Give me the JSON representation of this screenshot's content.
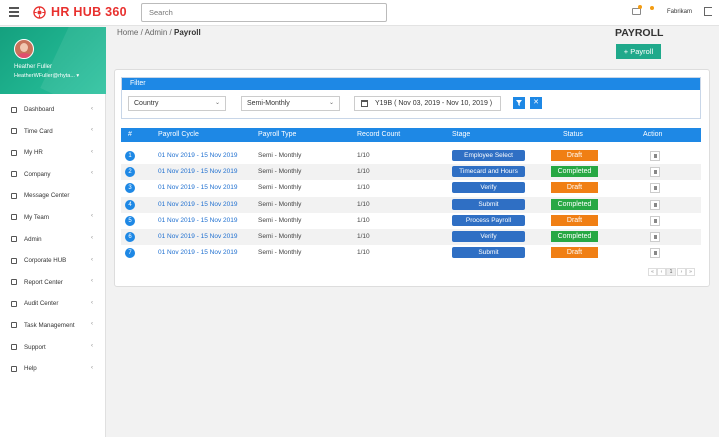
{
  "header": {
    "brand": "HR HUB 360",
    "search_placeholder": "Search",
    "company": "Fabrikam"
  },
  "profile": {
    "name": "Heather Fuller",
    "email": "HeatherWFuller@rhyta... ▾"
  },
  "sidebar": {
    "items": [
      {
        "label": "Dashboard",
        "icon": "dashboard-icon"
      },
      {
        "label": "Time Card",
        "icon": "calendar-icon"
      },
      {
        "label": "My HR",
        "icon": "users-icon"
      },
      {
        "label": "Company",
        "icon": "briefcase-icon"
      },
      {
        "label": "Message Center",
        "icon": "envelope-icon"
      },
      {
        "label": "My Team",
        "icon": "team-icon"
      },
      {
        "label": "Admin",
        "icon": "admin-icon"
      },
      {
        "label": "Corporate HUB",
        "icon": "building-icon"
      },
      {
        "label": "Report Center",
        "icon": "report-icon"
      },
      {
        "label": "Audit Center",
        "icon": "history-icon"
      },
      {
        "label": "Task Management",
        "icon": "tasks-icon"
      },
      {
        "label": "Support",
        "icon": "support-icon"
      },
      {
        "label": "Help",
        "icon": "help-icon"
      }
    ],
    "arrow": "‹"
  },
  "breadcrumb": {
    "home": "Home",
    "sep1": "/",
    "admin": "Admin",
    "sep2": "/",
    "current": "Payroll"
  },
  "page": {
    "title": "PAYROLL",
    "add_button": "+ Payroll"
  },
  "filter": {
    "title": "Filter",
    "country": "Country",
    "period": "Semi-Monthly",
    "date_range": "Y19B ( Nov 03, 2019 - Nov 10, 2019 )",
    "apply_icon": "filter-icon",
    "clear_icon": "close-icon"
  },
  "table": {
    "columns": [
      "#",
      "Payroll Cycle",
      "Payroll Type",
      "Record Count",
      "Stage",
      "Status",
      "Action"
    ],
    "rows": [
      {
        "num": "1",
        "cycle": "01 Nov 2019 - 15 Nov 2019",
        "type": "Semi - Monthly",
        "count": "1/10",
        "stage": "Employee Select",
        "status": "Draft"
      },
      {
        "num": "2",
        "cycle": "01 Nov 2019 - 15 Nov 2019",
        "type": "Semi - Monthly",
        "count": "1/10",
        "stage": "Timecard and Hours",
        "status": "Completed"
      },
      {
        "num": "3",
        "cycle": "01 Nov 2019 - 15 Nov 2019",
        "type": "Semi - Monthly",
        "count": "1/10",
        "stage": "Verify",
        "status": "Draft"
      },
      {
        "num": "4",
        "cycle": "01 Nov 2019 - 15 Nov 2019",
        "type": "Semi - Monthly",
        "count": "1/10",
        "stage": "Submit",
        "status": "Completed"
      },
      {
        "num": "5",
        "cycle": "01 Nov 2019 - 15 Nov 2019",
        "type": "Semi - Monthly",
        "count": "1/10",
        "stage": "Process Payroll",
        "status": "Draft"
      },
      {
        "num": "6",
        "cycle": "01 Nov 2019 - 15 Nov 2019",
        "type": "Semi - Monthly",
        "count": "1/10",
        "stage": "Verify",
        "status": "Completed"
      },
      {
        "num": "7",
        "cycle": "01 Nov 2019 - 15 Nov 2019",
        "type": "Semi - Monthly",
        "count": "1/10",
        "stage": "Submit",
        "status": "Draft"
      }
    ]
  },
  "pagination": {
    "first": "«",
    "prev": "‹",
    "current": "1",
    "next": "›",
    "last": "»"
  },
  "colors": {
    "brand": "#e8302e",
    "primary": "#1e88e5",
    "teal": "#1fa98b",
    "draft": "#f07f14",
    "completed": "#27a844"
  }
}
